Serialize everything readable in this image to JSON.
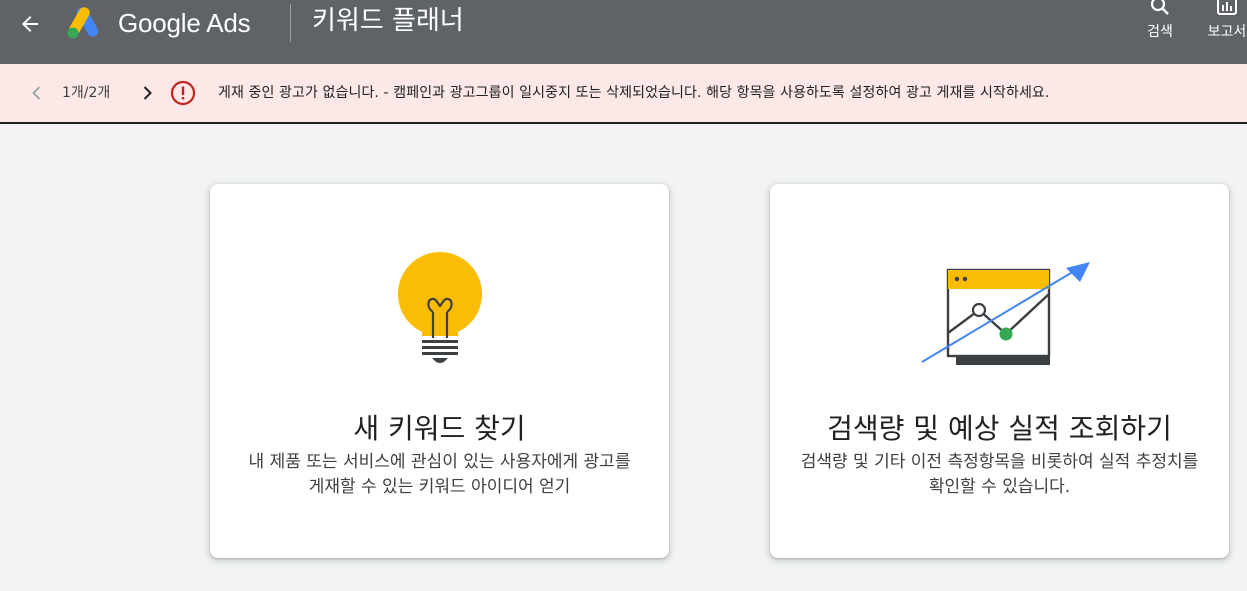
{
  "appbar": {
    "product_name": "Google Ads",
    "page_title": "키워드 플래너",
    "tools": [
      {
        "label": "검색",
        "icon": "search-icon"
      },
      {
        "label": "보고서",
        "icon": "reports-icon"
      }
    ]
  },
  "notice": {
    "pager": "1개/2개",
    "message": "게재 중인 광고가 없습니다. - 캠페인과 광고그룹이 일시중지 또는 삭제되었습니다. 해당 항목을 사용하도록 설정하여 광고 게재를 시작하세요.",
    "icon": "error-icon"
  },
  "cards": [
    {
      "title": "새 키워드 찾기",
      "description": "내 제품 또는 서비스에 관심이 있는 사용자에게 광고를 게재할 수 있는 키워드 아이디어 얻기",
      "icon": "lightbulb-icon"
    },
    {
      "title": "검색량 및 예상 실적 조회하기",
      "description": "검색량 및 기타 이전 측정항목을 비롯하여 실적 추정치를 확인할 수 있습니다.",
      "icon": "trend-chart-icon"
    }
  ],
  "colors": {
    "appbar": "#5f6368",
    "notice_bg": "#fce8e6",
    "error_red": "#c5221f",
    "bulb_yellow": "#fbbc04",
    "arrow_blue": "#4285f4",
    "dot_green": "#34a853"
  }
}
